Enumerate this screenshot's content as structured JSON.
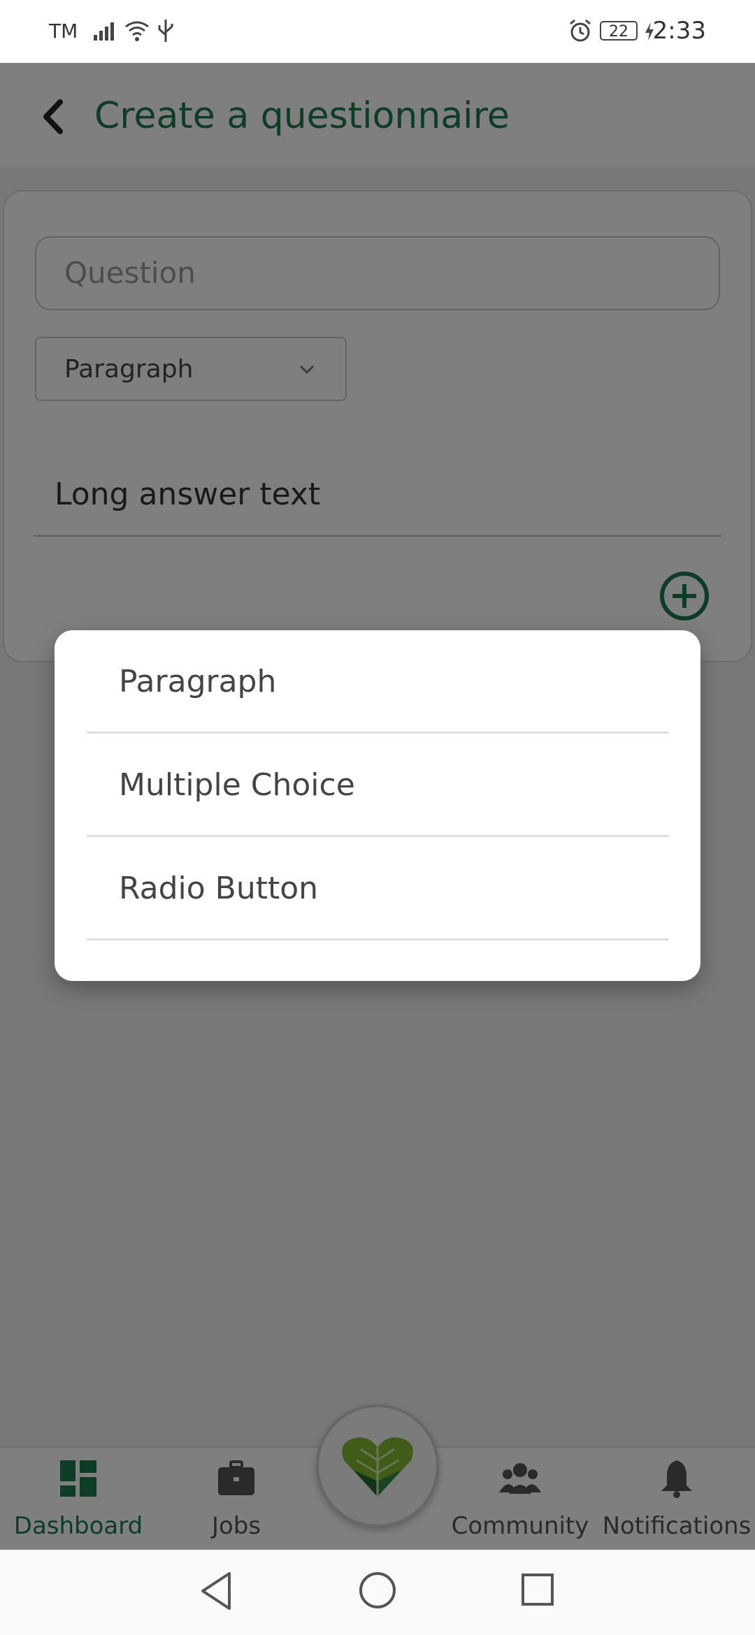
{
  "status_bar": {
    "carrier": "TM",
    "battery": "22",
    "time": "2:33",
    "icons": [
      "signal-icon",
      "wifi-icon",
      "usb-icon",
      "alarm-icon",
      "battery-icon",
      "charging-icon"
    ]
  },
  "app_bar": {
    "title": "Create a questionnaire",
    "back_icon": "chevron-left-icon"
  },
  "form": {
    "question_placeholder": "Question",
    "type_selected": "Paragraph",
    "answer_preview": "Long answer text",
    "add_icon": "plus-circle-icon"
  },
  "dialog": {
    "options": [
      {
        "label": "Paragraph"
      },
      {
        "label": "Multiple Choice"
      },
      {
        "label": "Radio Button"
      }
    ]
  },
  "bottom_nav": {
    "items": [
      {
        "label": "Dashboard",
        "icon": "dashboard-icon",
        "active": true
      },
      {
        "label": "Jobs",
        "icon": "briefcase-icon",
        "active": false
      },
      {
        "label": "Community",
        "icon": "people-icon",
        "active": false
      },
      {
        "label": "Notifications",
        "icon": "bell-icon",
        "active": false
      }
    ],
    "center_icon": "heart-logo-icon"
  },
  "system_nav": {
    "icons": [
      "back-triangle-icon",
      "home-circle-icon",
      "recents-square-icon"
    ]
  },
  "colors": {
    "accent": "#1a7a4f",
    "scrim": "rgba(0,0,0,0.5)"
  }
}
